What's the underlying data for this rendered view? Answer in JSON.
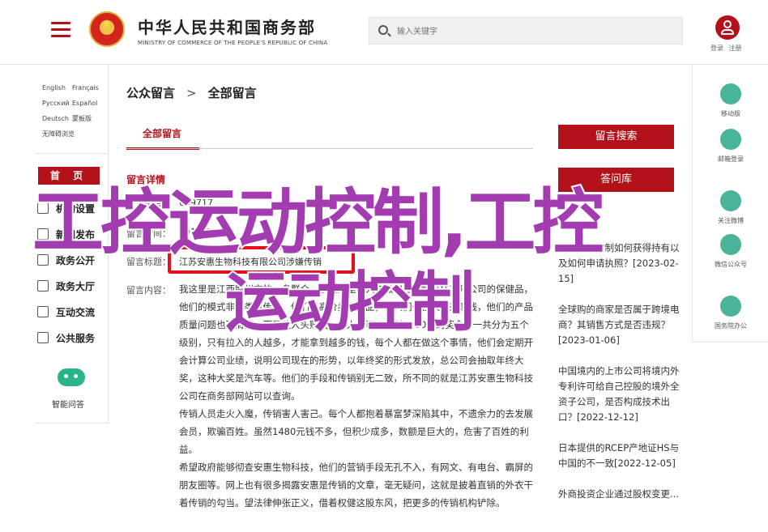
{
  "header": {
    "ministry_cn": "中华人民共和国商务部",
    "ministry_en": "MINISTRY OF COMMERCE OF THE PEOPLE'S REPUBLIC OF CHINA",
    "search_placeholder": "输入关键字",
    "login": "登录",
    "register": "注册"
  },
  "left": {
    "languages": [
      "English",
      "Français",
      "Русский",
      "Español",
      "Deutsch",
      "蒙板版",
      "无障碍浏览"
    ],
    "home": "首 页",
    "nav": [
      {
        "label": "机构设置",
        "icon": "building-icon"
      },
      {
        "label": "新闻发布",
        "icon": "news-icon"
      },
      {
        "label": "政务公开",
        "icon": "document-icon"
      },
      {
        "label": "政务大厅",
        "icon": "hall-icon"
      },
      {
        "label": "互动交流",
        "icon": "chat-icon"
      },
      {
        "label": "公共服务",
        "icon": "service-icon"
      }
    ],
    "ai_label": "智能问答"
  },
  "main": {
    "breadcrumb": [
      "公众留言",
      "全部留言"
    ],
    "tab": "全部留言",
    "detail_title": "留言详情",
    "fields": [
      {
        "label": "留言编号：",
        "value": "689717"
      },
      {
        "label": "留言时间：",
        "value": "2019-01-14"
      },
      {
        "label": "留言标题：",
        "value": "江苏安惠生物科技有限公司涉嫌传销"
      }
    ],
    "content_label": "留言内容：",
    "paragraphs": [
      "我这里是江西赣州市的一名群众，我们这里有人在做安惠生物科技有限公司的保健品，他们的模式非常类似传销，他们以高价卖出产品，让人们去拉人头来赚钱，他们的产品质量问题也不清楚，而是拉人头赚钱，拉人头可以得到1400元的奖金，一共分为五个级别，只有拉入的人越多，才能拿到越多的钱，每个人都在做这个事情，他们会定期开会计算公司业绩，说明公司现在的形势，以年终奖的形式发放，总公司会抽取年终大奖，这种大奖是汽车等。他们的手段和传销别无二致，所不同的就是江苏安惠生物科技公司在商务部网站可以查询。",
      "传销人员走火入魔，传销害人害己。每个人都抱着暴富梦深陷其中，不遗余力的去发展会员，欺骗百姓。虽然1480元钱不多，但积少成多，数额是巨大的，危害了百姓的利益。",
      "希望政府能够彻查安惠生物科技，他们的营销手段无孔不入，有网文、有电台、霸屏的朋友圈等。网上也有很多揭露安惠是传销的文章，毫无疑问，这就是披着直销的外衣干着传销的勾当。望法律伸张正义，借着权健这股东风，把更多的传销机构铲除。"
    ]
  },
  "right": {
    "search_btn": "留言搜索",
    "faq_btn": "答问库",
    "faq_items": [
      "工控运动控制如何获得持有以及如何申请执照？[2023-02-15]",
      "全球购的商家是否属于跨境电商？其销售方式是否违规？[2023-01-06]",
      "中国境内的上市公司将境内外专利许可给自己控股的境外全资子公司，是否构成技术出口？[2022-12-12]",
      "日本提供的RCEP产地证HS与中国的不一致[2022-12-05]",
      "外商投资企业通过股权变更..."
    ]
  },
  "far": [
    {
      "label": "移动版",
      "icon": "mobile-icon"
    },
    {
      "label": "邮箱登录",
      "icon": "mail-icon"
    },
    {
      "label": "关注微博",
      "icon": "weibo-icon"
    },
    {
      "label": "微信公众号",
      "icon": "wechat-icon"
    },
    {
      "label": "国务院办公",
      "icon": "at-icon"
    }
  ],
  "watermark": {
    "line1": "工控运动控制,工控",
    "line2": "运动控制"
  },
  "colors": {
    "brand": "#b4121b",
    "watermark": "#a23cb0",
    "highlight": "#e4101a",
    "accent": "#2aa787"
  }
}
